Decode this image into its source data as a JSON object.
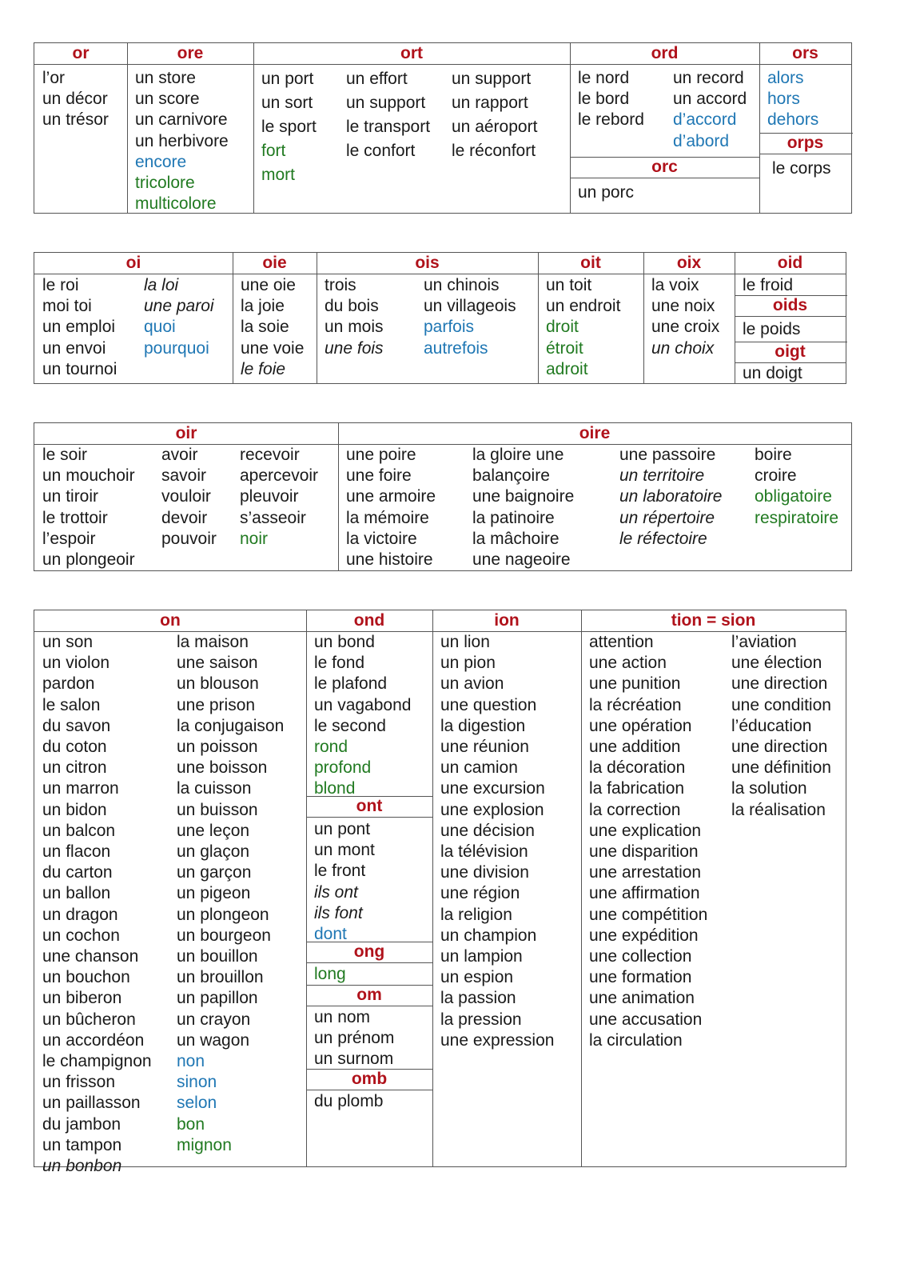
{
  "table1": {
    "or": {
      "header": "or",
      "words": [
        {
          "t": "l’or"
        },
        {
          "t": "un décor"
        },
        {
          "t": "un trésor"
        }
      ]
    },
    "ore": {
      "header": "ore",
      "words": [
        {
          "t": "un store"
        },
        {
          "t": "un score"
        },
        {
          "t": "un carnivore"
        },
        {
          "t": "un herbivore"
        },
        {
          "t": "encore",
          "c": "blue"
        },
        {
          "t": "tricolore",
          "c": "green"
        },
        {
          "t": "multicolore",
          "c": "green"
        }
      ]
    },
    "ort": {
      "header": "ort",
      "columns": [
        [
          {
            "t": "un port"
          },
          {
            "t": "un sort"
          },
          {
            "t": "le sport"
          },
          {
            "t": "fort",
            "c": "green"
          },
          {
            "t": "mort",
            "c": "green"
          }
        ],
        [
          {
            "t": "un effort"
          },
          {
            "t": "un support"
          },
          {
            "t": "le transport"
          },
          {
            "t": "le confort"
          }
        ],
        [
          {
            "t": "un support"
          },
          {
            "t": "un  rapport"
          },
          {
            "t": "un aéroport"
          },
          {
            "t": "le réconfort"
          }
        ]
      ]
    },
    "ord": {
      "header": "ord",
      "columns": [
        [
          {
            "t": "le nord"
          },
          {
            "t": "le bord"
          },
          {
            "t": "le rebord"
          }
        ],
        [
          {
            "t": "un record"
          },
          {
            "t": "un accord"
          },
          {
            "t": "d’accord",
            "c": "blue"
          },
          {
            "t": "d’abord",
            "c": "blue"
          }
        ]
      ]
    },
    "orc": {
      "header": "orc",
      "words": [
        {
          "t": "un porc"
        }
      ]
    },
    "ors": {
      "header": "ors",
      "words": [
        {
          "t": "alors",
          "c": "blue"
        },
        {
          "t": "hors",
          "c": "blue"
        },
        {
          "t": "dehors",
          "c": "blue"
        }
      ]
    },
    "orps": {
      "header": "orps",
      "words": [
        {
          "t": "le corps"
        }
      ]
    }
  },
  "table2": {
    "oi": {
      "header": "oi",
      "columns": [
        [
          {
            "t": "le roi"
          },
          {
            "t": "moi toi"
          },
          {
            "t": "un emploi"
          },
          {
            "t": "un envoi"
          },
          {
            "t": "un tournoi"
          }
        ],
        [
          {
            "t": "la loi",
            "c": "it"
          },
          {
            "t": "une paroi",
            "c": "it"
          },
          {
            "t": "quoi",
            "c": "blue"
          },
          {
            "t": "pourquoi",
            "c": "blue"
          }
        ]
      ]
    },
    "oie": {
      "header": "oie",
      "words": [
        {
          "t": "une oie"
        },
        {
          "t": "la joie"
        },
        {
          "t": "la soie"
        },
        {
          "t": "une voie"
        },
        {
          "t": "le foie",
          "c": "it"
        }
      ]
    },
    "ois": {
      "header": "ois",
      "columns": [
        [
          {
            "t": "trois"
          },
          {
            "t": "du bois"
          },
          {
            "t": "un mois"
          },
          {
            "t": "une fois",
            "c": "it"
          }
        ],
        [
          {
            "t": "un chinois"
          },
          {
            "t": "un villageois"
          },
          {
            "t": "parfois",
            "c": "blue"
          },
          {
            "t": "autrefois",
            "c": "blue"
          }
        ]
      ]
    },
    "oit": {
      "header": "oit",
      "words": [
        {
          "t": "un toit"
        },
        {
          "t": "un endroit"
        },
        {
          "t": "droit",
          "c": "green"
        },
        {
          "t": "étroit",
          "c": "green"
        },
        {
          "t": "adroit",
          "c": "green"
        }
      ]
    },
    "oix": {
      "header": "oix",
      "words": [
        {
          "t": "la voix"
        },
        {
          "t": "une noix"
        },
        {
          "t": "une croix"
        },
        {
          "t": "un choix",
          "c": "it"
        }
      ]
    },
    "oid": {
      "header": "oid",
      "words": [
        {
          "t": "le froid"
        }
      ]
    },
    "oids": {
      "header": "oids",
      "words": [
        {
          "t": "le poids"
        }
      ]
    },
    "oigt": {
      "header": "oigt",
      "words": [
        {
          "t": "un doigt"
        }
      ]
    }
  },
  "table3": {
    "oir": {
      "header": "oir",
      "columns": [
        [
          {
            "t": "le soir"
          },
          {
            "t": "un mouchoir"
          },
          {
            "t": "un tiroir"
          },
          {
            "t": "le trottoir"
          },
          {
            "t": "l’espoir"
          },
          {
            "t": "un plongeoir"
          }
        ],
        [
          {
            "t": "avoir"
          },
          {
            "t": "savoir"
          },
          {
            "t": "vouloir"
          },
          {
            "t": "devoir"
          },
          {
            "t": "pouvoir"
          }
        ],
        [
          {
            "t": "recevoir"
          },
          {
            "t": "apercevoir"
          },
          {
            "t": "pleuvoir"
          },
          {
            "t": "s’asseoir"
          },
          {
            "t": "noir",
            "c": "green"
          }
        ]
      ]
    },
    "oire": {
      "header": "oire",
      "columns": [
        [
          {
            "t": "une poire"
          },
          {
            "t": "une foire"
          },
          {
            "t": "une armoire"
          },
          {
            "t": "la mémoire"
          },
          {
            "t": "la victoire"
          },
          {
            "t": "une histoire"
          }
        ],
        [
          {
            "t": "la gloire une"
          },
          {
            "t": "balançoire"
          },
          {
            "t": "une baignoire"
          },
          {
            "t": "la patinoire"
          },
          {
            "t": "la mâchoire"
          },
          {
            "t": "une nageoire"
          }
        ],
        [
          {
            "t": "une passoire"
          },
          {
            "t": "un territoire",
            "c": "it"
          },
          {
            "t": "un laboratoire",
            "c": "it"
          },
          {
            "t": "un répertoire",
            "c": "it"
          },
          {
            "t": "le réfectoire",
            "c": "it"
          }
        ],
        [
          {
            "t": "boire"
          },
          {
            "t": "croire"
          },
          {
            "t": "obligatoire",
            "c": "green"
          },
          {
            "t": "respiratoire",
            "c": "green"
          }
        ]
      ]
    }
  },
  "table4": {
    "on": {
      "header": "on",
      "columns": [
        [
          {
            "t": "un son"
          },
          {
            "t": "un violon"
          },
          {
            "t": "pardon"
          },
          {
            "t": "le salon"
          },
          {
            "t": "du savon"
          },
          {
            "t": "du coton"
          },
          {
            "t": "un citron"
          },
          {
            "t": "un marron"
          },
          {
            "t": "un bidon"
          },
          {
            "t": "un balcon"
          },
          {
            "t": "un flacon"
          },
          {
            "t": "du carton"
          },
          {
            "t": "un ballon"
          },
          {
            "t": "un dragon"
          },
          {
            "t": "un cochon"
          },
          {
            "t": "une chanson"
          },
          {
            "t": "un bouchon"
          },
          {
            "t": "un biberon"
          },
          {
            "t": "un bûcheron"
          },
          {
            "t": "un accordéon"
          },
          {
            "t": "le champignon"
          },
          {
            "t": "un frisson"
          },
          {
            "t": "un paillasson"
          },
          {
            "t": "du jambon"
          },
          {
            "t": "un tampon"
          },
          {
            "t": "un bonbon",
            "c": "it"
          }
        ],
        [
          {
            "t": "la maison"
          },
          {
            "t": "une saison"
          },
          {
            "t": "un blouson"
          },
          {
            "t": "une prison"
          },
          {
            "t": "la conjugaison"
          },
          {
            "t": "un poisson"
          },
          {
            "t": "une boisson"
          },
          {
            "t": "la cuisson"
          },
          {
            "t": "un buisson"
          },
          {
            "t": "une leçon"
          },
          {
            "t": "un glaçon"
          },
          {
            "t": "un garçon"
          },
          {
            "t": "un pigeon"
          },
          {
            "t": "un plongeon"
          },
          {
            "t": "un bourgeon"
          },
          {
            "t": "un bouillon"
          },
          {
            "t": "un brouillon"
          },
          {
            "t": "un papillon"
          },
          {
            "t": "un crayon"
          },
          {
            "t": "un wagon"
          },
          {
            "t": "non",
            "c": "blue"
          },
          {
            "t": "sinon",
            "c": "blue"
          },
          {
            "t": "selon",
            "c": "blue"
          },
          {
            "t": "bon",
            "c": "green"
          },
          {
            "t": "mignon",
            "c": "green"
          }
        ]
      ]
    },
    "ond": {
      "header": "ond",
      "words": [
        {
          "t": "un bond"
        },
        {
          "t": "le fond"
        },
        {
          "t": "le plafond"
        },
        {
          "t": "un vagabond"
        },
        {
          "t": "le second"
        },
        {
          "t": "rond",
          "c": "green"
        },
        {
          "t": "profond",
          "c": "green"
        },
        {
          "t": "blond",
          "c": "green"
        }
      ]
    },
    "ont": {
      "header": "ont",
      "words": [
        {
          "t": "un pont"
        },
        {
          "t": "un mont"
        },
        {
          "t": "le front"
        },
        {
          "t": "ils ont",
          "c": "it"
        },
        {
          "t": "ils font",
          "c": "it"
        },
        {
          "t": "dont",
          "c": "blue"
        }
      ]
    },
    "ong": {
      "header": "ong",
      "words": [
        {
          "t": "long",
          "c": "green"
        }
      ]
    },
    "om": {
      "header": "om",
      "words": [
        {
          "t": "un nom"
        },
        {
          "t": "un prénom"
        },
        {
          "t": "un surnom"
        }
      ]
    },
    "omb": {
      "header": "omb",
      "words": [
        {
          "t": "du plomb"
        }
      ]
    },
    "ion": {
      "header": "ion",
      "words": [
        {
          "t": "un lion"
        },
        {
          "t": "un pion"
        },
        {
          "t": "un avion"
        },
        {
          "t": "une question"
        },
        {
          "t": "la digestion"
        },
        {
          "t": "une réunion"
        },
        {
          "t": "un camion"
        },
        {
          "t": "une excursion"
        },
        {
          "t": "une explosion"
        },
        {
          "t": "une décision"
        },
        {
          "t": "la télévision"
        },
        {
          "t": "une division"
        },
        {
          "t": "une région"
        },
        {
          "t": "la religion"
        },
        {
          "t": "un champion"
        },
        {
          "t": "un lampion"
        },
        {
          "t": "un espion"
        },
        {
          "t": "la passion"
        },
        {
          "t": "la pression"
        },
        {
          "t": "une expression"
        }
      ]
    },
    "tion": {
      "header": "tion = sion",
      "columns": [
        [
          {
            "t": "attention"
          },
          {
            "t": "une action"
          },
          {
            "t": "une punition"
          },
          {
            "t": "la récréation"
          },
          {
            "t": "une opération"
          },
          {
            "t": "une addition"
          },
          {
            "t": "la décoration"
          },
          {
            "t": "la fabrication"
          },
          {
            "t": "la correction"
          },
          {
            "t": "une explication"
          },
          {
            "t": "une disparition"
          },
          {
            "t": "une arrestation"
          },
          {
            "t": "une affirmation"
          },
          {
            "t": "une compétition"
          },
          {
            "t": "une expédition"
          },
          {
            "t": "une collection"
          },
          {
            "t": "une formation"
          },
          {
            "t": "une animation"
          },
          {
            "t": "une accusation"
          },
          {
            "t": "la circulation"
          }
        ],
        [
          {
            "t": "l’aviation"
          },
          {
            "t": "une élection"
          },
          {
            "t": "une direction"
          },
          {
            "t": "une condition"
          },
          {
            "t": "l’éducation"
          },
          {
            "t": "une direction"
          },
          {
            "t": "une définition"
          },
          {
            "t": "la solution"
          },
          {
            "t": "la réalisation"
          }
        ]
      ]
    }
  }
}
